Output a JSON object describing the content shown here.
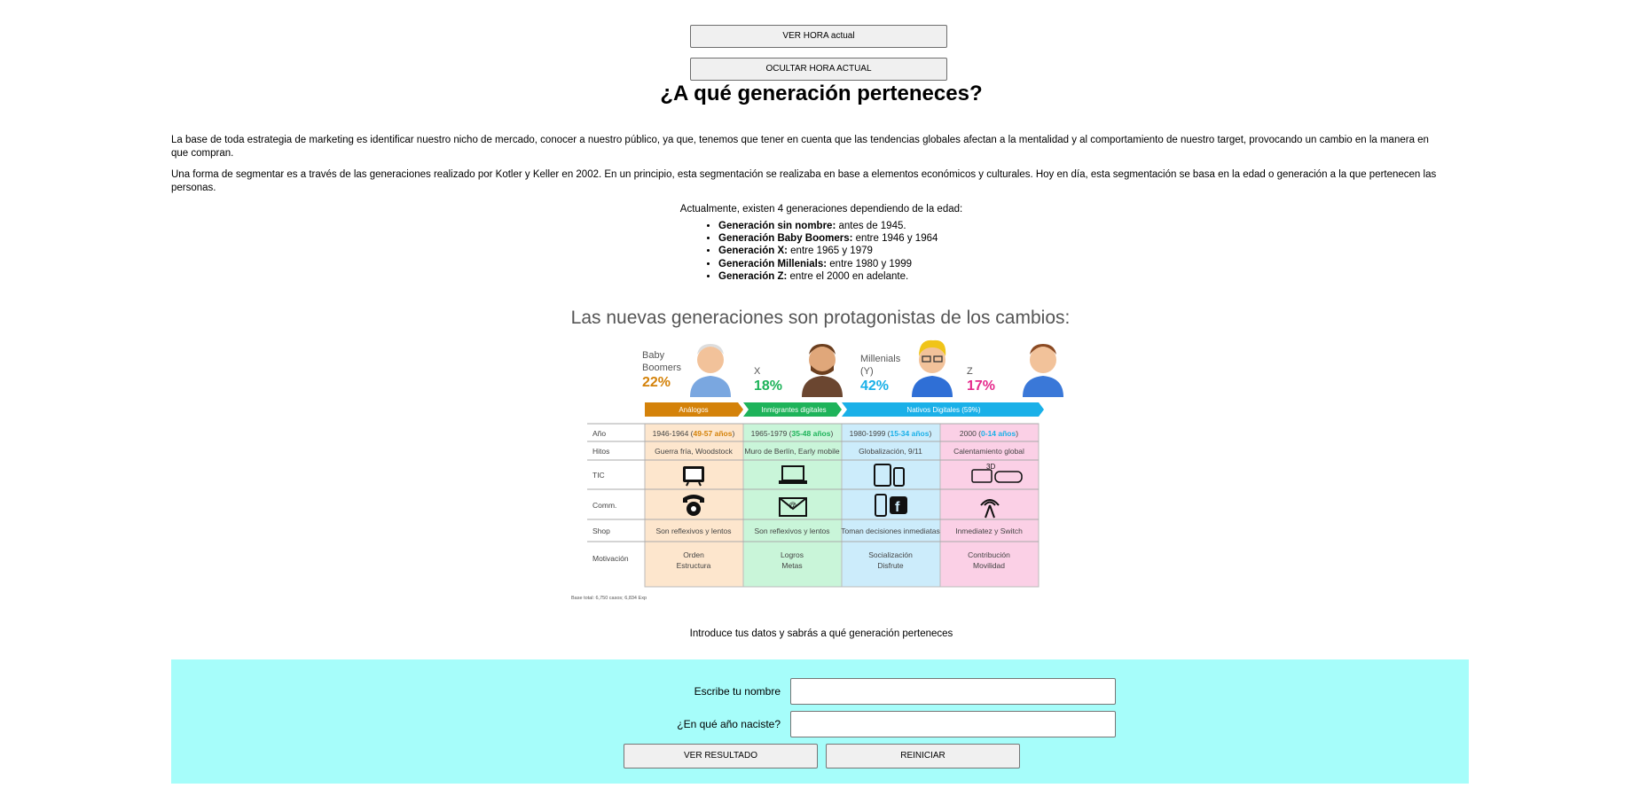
{
  "buttons": {
    "show_time": "VER HORA actual",
    "hide_time": "OCULTAR HORA ACTUAL"
  },
  "title": "¿A qué generación perteneces?",
  "paragraphs": [
    "La base de toda estrategia de marketing es identificar nuestro nicho de mercado, conocer a nuestro público, ya que, tenemos que tener en cuenta que las tendencias globales afectan a la mentalidad y al comportamiento de nuestro target, provocando un cambio en la manera en que compran.",
    "Una forma de segmentar es a través de las generaciones realizado por Kotler y Keller en 2002. En un principio, esta segmentación se realizaba en base a elementos económicos y culturales. Hoy en día, esta segmentación se basa en la edad o generación a la que pertenecen las personas."
  ],
  "intro_list": "Actualmente, existen 4 generaciones dependiendo de la edad:",
  "generations": [
    {
      "name": "Generación sin nombre:",
      "range": " antes de 1945."
    },
    {
      "name": "Generación Baby Boomers:",
      "range": " entre 1946 y 1964"
    },
    {
      "name": "Generación X:",
      "range": " entre 1965 y 1979"
    },
    {
      "name": "Generación Millenials:",
      "range": " entre 1980 y 1999"
    },
    {
      "name": "Generación Z:",
      "range": " entre el 2000 en adelante."
    }
  ],
  "infographic": {
    "title": "Las nuevas generaciones son protagonistas de los cambios:",
    "groups": [
      {
        "label": "Baby Boomers",
        "pct": "22%",
        "color": "#d4820a"
      },
      {
        "label": "X",
        "pct": "18%",
        "color": "#1eb35a"
      },
      {
        "label": "Millenials (Y)",
        "pct": "42%",
        "color": "#1ab0e8"
      },
      {
        "label": "Z",
        "pct": "17%",
        "color": "#e52a8c"
      }
    ],
    "bands": [
      "Análogos",
      "Inmigrantes digitales",
      "Nativos Digitales (59%)"
    ],
    "row_labels": [
      "Año",
      "Hitos",
      "TIC",
      "Comm.",
      "Shop",
      "Motivación"
    ],
    "columns": [
      {
        "year": "1946-1964 (",
        "age": "49-57 años",
        "year_end": ")",
        "hitos": "Guerra fría, Woodstock",
        "shop": "Son reflexivos y lentos",
        "mot1": "Orden",
        "mot2": "Estructura"
      },
      {
        "year": "1965-1979 (",
        "age": "35-48 años",
        "year_end": ")",
        "hitos": "Muro de Berlín, Early mobile",
        "shop": "Son reflexivos y lentos",
        "mot1": "Logros",
        "mot2": "Metas"
      },
      {
        "year": "1980-1999 (",
        "age": "15-34 años",
        "year_end": ")",
        "hitos": "Globalización, 9/11",
        "shop": "Toman decisiones inmediatas",
        "mot1": "Socialización",
        "mot2": "Disfrute"
      },
      {
        "year": "2000 (",
        "age": "0-14 años",
        "year_end": ")",
        "hitos": "Calentamiento global",
        "shop": "Inmediatez y Switch",
        "mot1": "Contribución",
        "mot2": "Movilidad"
      }
    ],
    "footnote": "Base total: 6,750 casos;  6,834 Exp"
  },
  "form_intro": "Introduce tus datos y sabrás a qué generación perteneces",
  "form": {
    "name_label": "Escribe tu nombre",
    "year_label": "¿En qué año naciste?",
    "submit": "VER RESULTADO",
    "reset": "REINICIAR"
  }
}
